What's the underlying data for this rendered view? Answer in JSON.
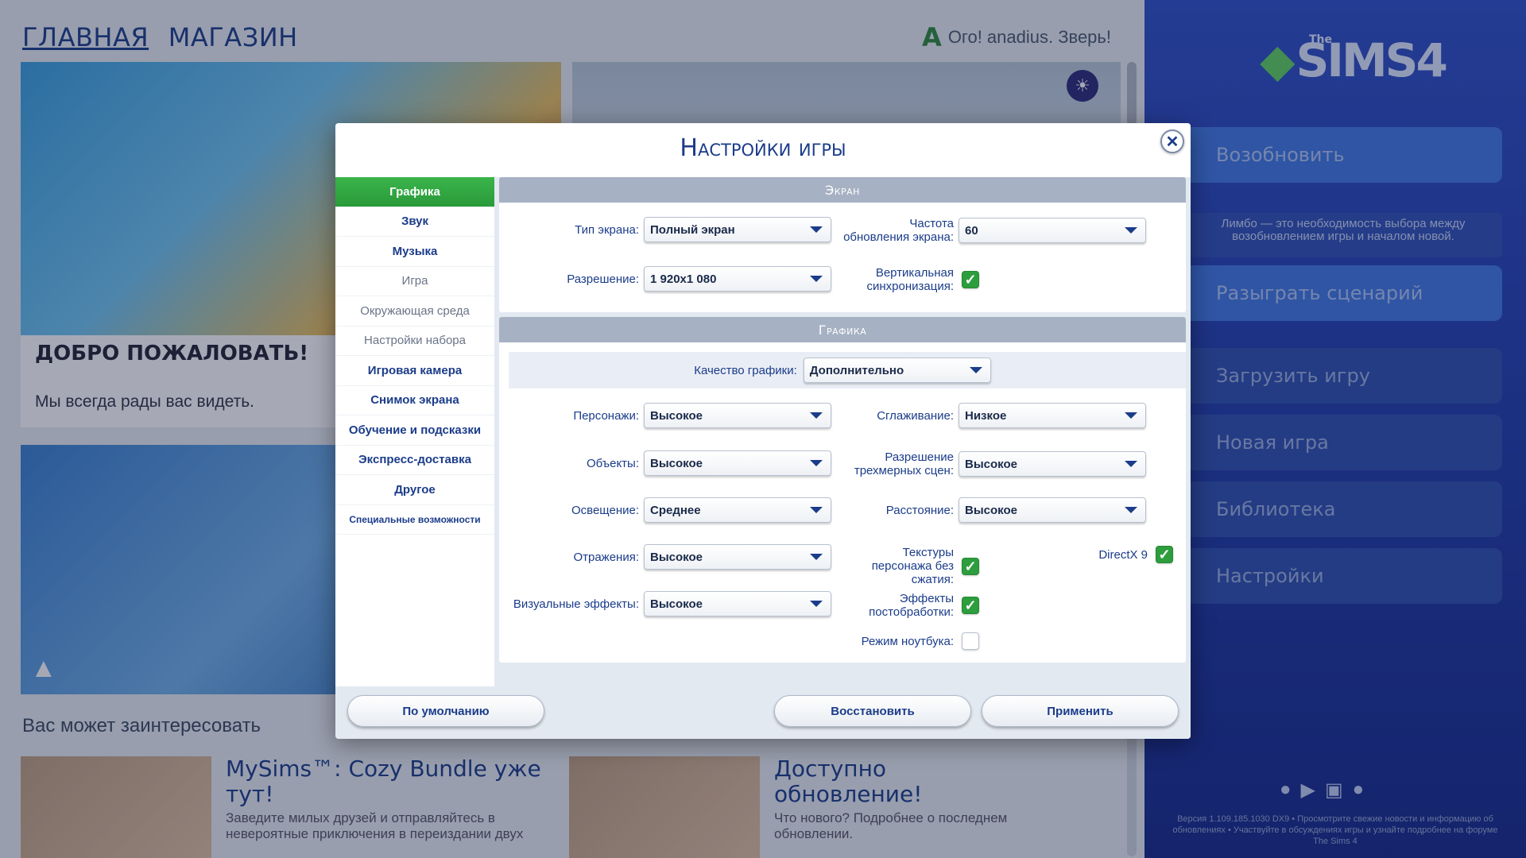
{
  "topnav": {
    "home": "ГЛАВНАЯ",
    "store": "МАГАЗИН"
  },
  "greeting": {
    "logo": "A",
    "text": "Ого! anadius. Зверь!"
  },
  "welcome": {
    "title": "ДОБРО ПОЖАЛОВАТЬ!",
    "subtitle": "Мы всегда рады вас видеть."
  },
  "interest_heading": "Вас может заинтересовать",
  "news": [
    {
      "title": "MySims™: Cozy Bundle уже тут!",
      "text": "Заведите милых друзей и отправляйтесь в невероятные приключения в переиздании двух"
    },
    {
      "title": "Доступно обновление!",
      "text": "Что нового? Подробнее о последнем обновлении."
    }
  ],
  "sidebar": {
    "logo_the": "The",
    "logo": "SIMS4",
    "resume": "Возобновить",
    "limbo": "Лимбо — это необходимость выбора между возобновлением игры и началом новой.",
    "scenario": "Разыграть сценарий",
    "load": "Загрузить игру",
    "new_game": "Новая игра",
    "library": "Библиотека",
    "settings": "Настройки",
    "version": "Версия 1.109.185.1030 DX9 • Просмотрите свежие новости и информацию об обновлениях • Участвуйте в обсуждениях игры и узнайте подробнее на форуме The Sims 4"
  },
  "dialog": {
    "title": "Настройки игры",
    "close": "✕",
    "nav": [
      "Графика",
      "Звук",
      "Музыка",
      "Игра",
      "Окружающая среда",
      "Настройки набора",
      "Игровая камера",
      "Снимок экрана",
      "Обучение и подсказки",
      "Экспресс-доставка",
      "Другое",
      "Специальные возможности"
    ],
    "screen": {
      "header": "Экран",
      "type_label": "Тип экрана:",
      "type_value": "Полный экран",
      "refresh_label": "Частота обновления экрана:",
      "refresh_value": "60",
      "res_label": "Разрешение:",
      "res_value": "1 920x1 080",
      "vsync_label": "Вертикальная синхронизация:"
    },
    "graphics": {
      "header": "Графика",
      "quality_label": "Качество графики:",
      "quality_value": "Дополнительно",
      "sims_label": "Персонажи:",
      "sims_value": "Высокое",
      "aa_label": "Сглаживание:",
      "aa_value": "Низкое",
      "objects_label": "Объекты:",
      "objects_value": "Высокое",
      "res3d_label": "Разрешение трехмерных сцен:",
      "res3d_value": "Высокое",
      "light_label": "Освещение:",
      "light_value": "Среднее",
      "dist_label": "Расстояние:",
      "dist_value": "Высокое",
      "refl_label": "Отражения:",
      "refl_value": "Высокое",
      "tex_label": "Текстуры персонажа без сжатия:",
      "dx9_label": "DirectX 9",
      "vfx_label": "Визуальные эффекты:",
      "vfx_value": "Высокое",
      "post_label": "Эффекты постобработки:",
      "laptop_label": "Режим ноутбука:"
    },
    "buttons": {
      "defaults": "По умолчанию",
      "restore": "Восстановить",
      "apply": "Применить"
    }
  }
}
